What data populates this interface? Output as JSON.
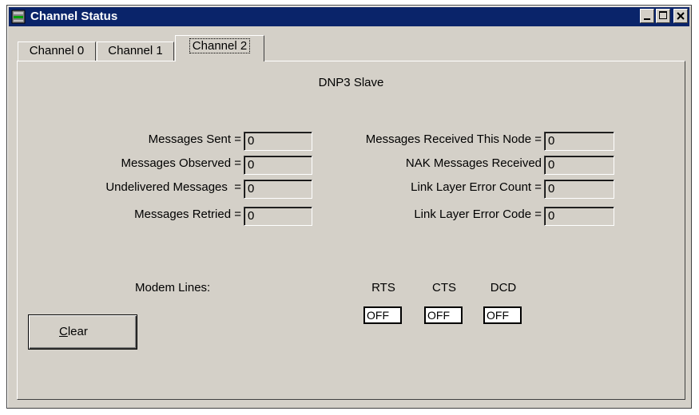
{
  "window": {
    "title": "Channel Status"
  },
  "tabs": [
    {
      "label": "Channel 0",
      "selected": false
    },
    {
      "label": "Channel 1",
      "selected": false
    },
    {
      "label": "Channel 2",
      "selected": true
    }
  ],
  "panel": {
    "protocol": "DNP3 Slave",
    "left_stats": [
      {
        "label": "Messages Sent =",
        "value": "0"
      },
      {
        "label": "Messages Observed =",
        "value": "0"
      },
      {
        "label": "Undelivered Messages  =",
        "value": "0"
      },
      {
        "label": "Messages Retried =",
        "value": "0"
      }
    ],
    "right_stats": [
      {
        "label": "Messages Received This Node =",
        "value": "0"
      },
      {
        "label": "NAK Messages Received",
        "value": "0"
      },
      {
        "label": "Link Layer Error Count =",
        "value": "0"
      },
      {
        "label": "Link Layer Error Code =",
        "value": "0"
      }
    ],
    "modem": {
      "label": "Modem Lines:",
      "lines": [
        {
          "name": "RTS",
          "state": "OFF"
        },
        {
          "name": "CTS",
          "state": "OFF"
        },
        {
          "name": "DCD",
          "state": "OFF"
        }
      ]
    },
    "clear_button": {
      "accel": "C",
      "rest": "lear"
    }
  },
  "icons": {
    "app": "network-channel-icon",
    "minimize": "minimize-icon",
    "maximize": "maximize-icon",
    "close": "close-icon"
  },
  "colors": {
    "titlebar": "#0a246a",
    "face": "#d4d0c8"
  }
}
